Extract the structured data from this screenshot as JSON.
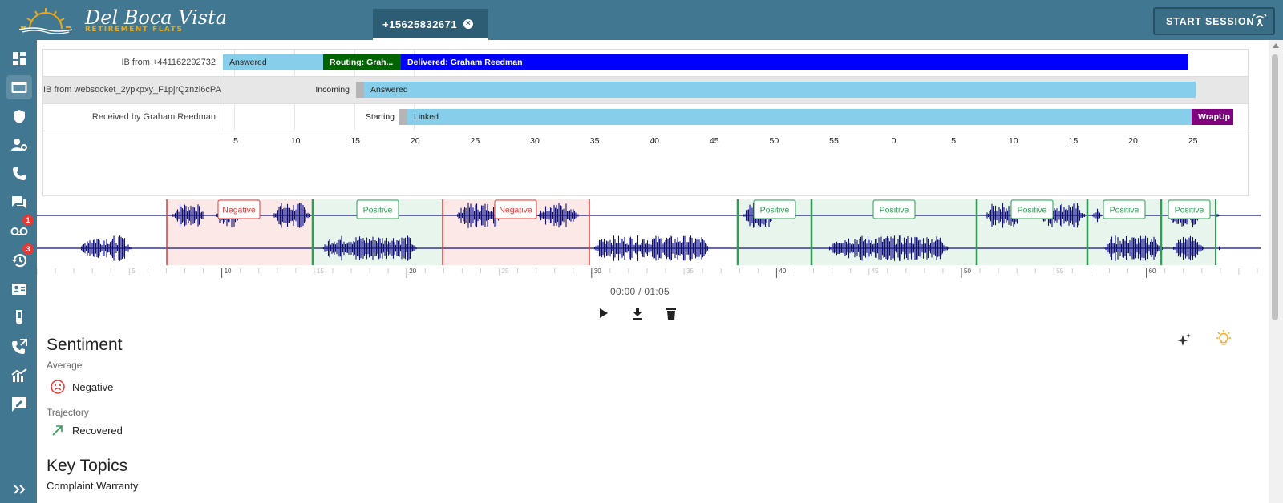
{
  "header": {
    "logo_title": "Del Boca Vista",
    "logo_subtitle": "RETIREMENT FLATS",
    "tab_label": "+15625832671",
    "start_session_label": "START SESSION"
  },
  "sidebar": {
    "items": [
      {
        "name": "dashboard-icon"
      },
      {
        "name": "folder-icon"
      },
      {
        "name": "shield-icon"
      },
      {
        "name": "user-settings-icon"
      },
      {
        "name": "phone-icon"
      },
      {
        "name": "chat-icon"
      },
      {
        "name": "voicemail-icon",
        "badge": "1"
      },
      {
        "name": "history-icon",
        "badge": "3"
      },
      {
        "name": "contact-card-icon"
      },
      {
        "name": "flask-icon"
      },
      {
        "name": "phone-forward-icon"
      },
      {
        "name": "analytics-icon"
      },
      {
        "name": "feedback-icon"
      },
      {
        "name": "expand-icon"
      }
    ]
  },
  "timeline": {
    "rows": [
      {
        "label": "IB from +441162292732",
        "segments": [
          "Answered",
          "Routing: Grah...",
          "Delivered: Graham Reedman"
        ]
      },
      {
        "label": "IB from websocket_2ypkpxy_F1pjrQznzl6cPA",
        "segments": [
          "Incoming",
          "Answered"
        ]
      },
      {
        "label": "Received by Graham Reedman",
        "segments": [
          "Starting",
          "Linked",
          "WrapUp"
        ]
      }
    ],
    "ticks": [
      "5",
      "10",
      "15",
      "20",
      "25",
      "30",
      "35",
      "40",
      "45",
      "50",
      "55",
      "0",
      "5",
      "10",
      "15",
      "20",
      "25"
    ]
  },
  "waveform": {
    "sentiment_tags": [
      "Negative",
      "Positive",
      "Negative",
      "Positive",
      "Positive",
      "Positive",
      "Positive",
      "Positive"
    ],
    "ruler_labels": [
      "5",
      "10",
      "15",
      "20",
      "25",
      "30",
      "35",
      "40",
      "45",
      "50",
      "55",
      "60"
    ]
  },
  "player": {
    "time": "00:00 / 01:05"
  },
  "sentiment": {
    "title": "Sentiment",
    "average_label": "Average",
    "average_value": "Negative",
    "trajectory_label": "Trajectory",
    "trajectory_value": "Recovered"
  },
  "key_topics": {
    "title": "Key Topics",
    "value": "Complaint,Warranty"
  },
  "colors": {
    "header_bg": "#417791",
    "answered": "#87ceeb",
    "routing": "#006400",
    "delivered": "#0000ff",
    "wrapup": "#800080",
    "negative": "#e53935",
    "positive": "#2e9e55",
    "wave": "#10107a"
  }
}
